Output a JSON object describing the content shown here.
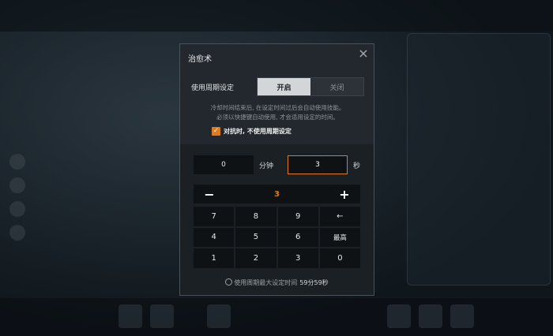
{
  "modal": {
    "title": "治愈术",
    "close_glyph": "×",
    "cycle_setting_label": "使用周期设定",
    "toggle": {
      "on_label": "开启",
      "off_label": "关闭",
      "selected": "开启"
    },
    "description_line1": "冷却时间结束后, 在设定时间过后会自动使用技能。",
    "description_line2": "必须以快捷键自动使用, 才会适用设定的时间。",
    "checkbox": {
      "checked": true,
      "glyph": "✓",
      "label": "对抗时, 不使用周期设定"
    },
    "minutes_value": "0",
    "minutes_unit": "分钟",
    "seconds_value": "3",
    "seconds_unit": "秒",
    "stepper": {
      "minus": "−",
      "value": "3",
      "plus": "+"
    },
    "keypad": {
      "k7": "7",
      "k8": "8",
      "k9": "9",
      "backspace": "←",
      "k4": "4",
      "k5": "5",
      "k6": "6",
      "max": "最高",
      "k1": "1",
      "k2": "2",
      "k3": "3",
      "k0": "0"
    },
    "footer_label": "使用周期最大设定时间",
    "footer_value": "59分59秒"
  },
  "colors": {
    "accent": "#e07a1f",
    "panel": "#22282e",
    "field": "#0e1215"
  },
  "icons": {
    "close": "close-icon",
    "clock": "clock-icon",
    "check": "checkmark-icon",
    "backspace": "backspace-icon"
  }
}
